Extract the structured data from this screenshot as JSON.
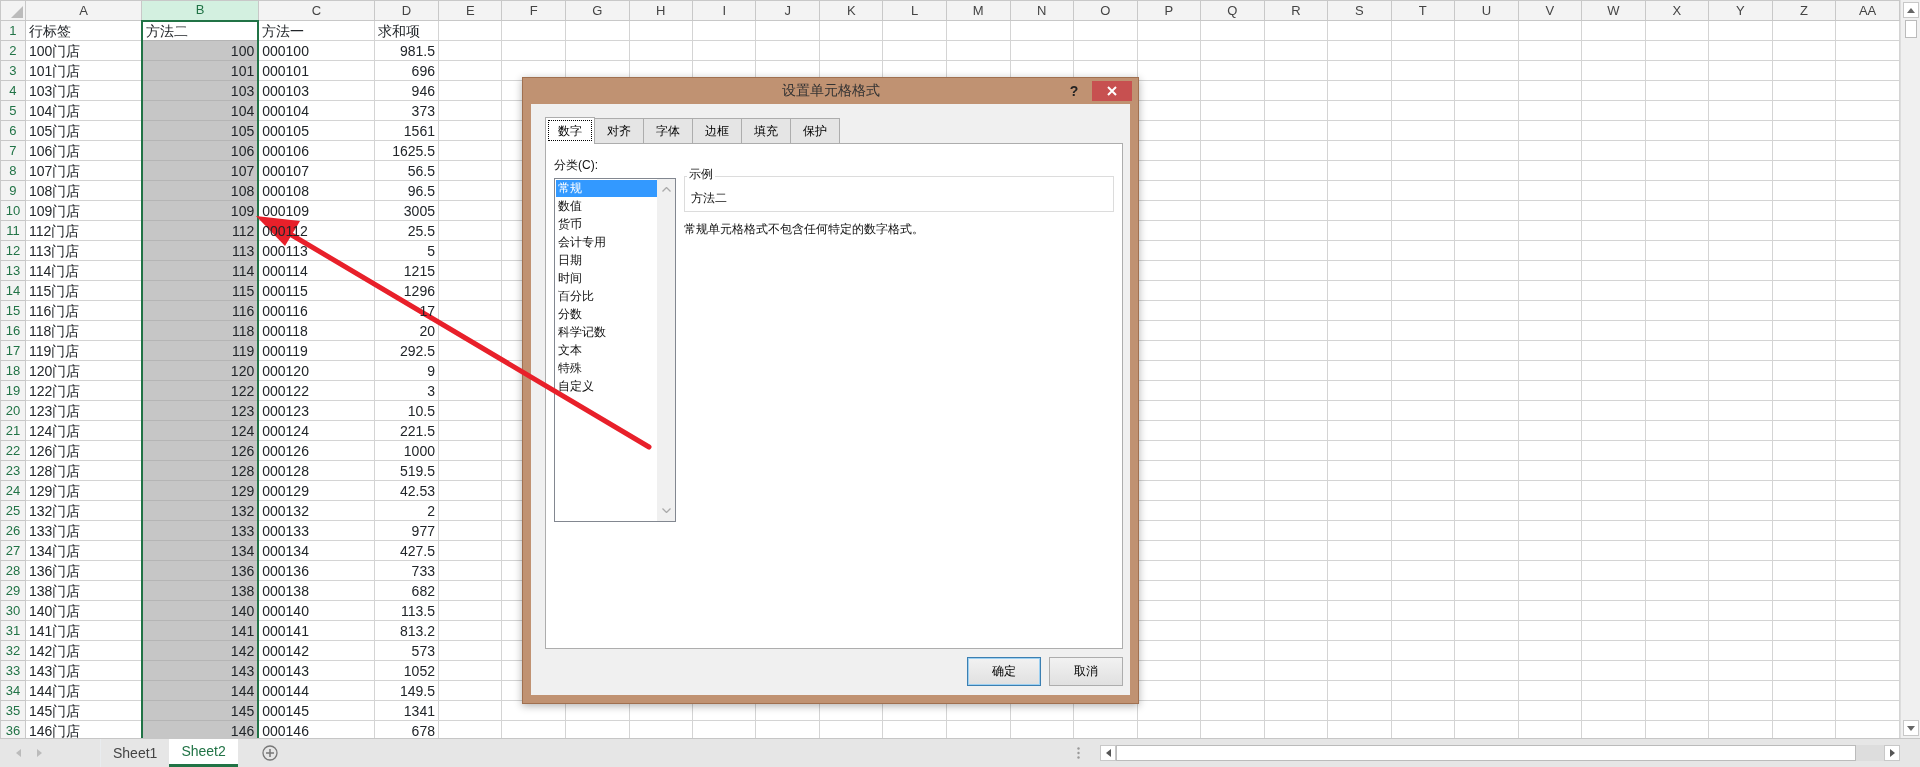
{
  "sheet": {
    "columns": [
      {
        "label": "A",
        "selected": false,
        "numeric": false
      },
      {
        "label": "B",
        "selected": true,
        "numeric": true
      },
      {
        "label": "C",
        "selected": false,
        "numeric": false
      },
      {
        "label": "D",
        "selected": false,
        "numeric": true
      },
      {
        "label": "E",
        "selected": false
      },
      {
        "label": "F",
        "selected": false
      },
      {
        "label": "G",
        "selected": false
      },
      {
        "label": "H",
        "selected": false
      },
      {
        "label": "I",
        "selected": false
      },
      {
        "label": "J",
        "selected": false
      },
      {
        "label": "K",
        "selected": false
      },
      {
        "label": "L",
        "selected": false
      },
      {
        "label": "M",
        "selected": false
      },
      {
        "label": "N",
        "selected": false
      },
      {
        "label": "O",
        "selected": false
      },
      {
        "label": "P",
        "selected": false
      },
      {
        "label": "Q",
        "selected": false
      },
      {
        "label": "R",
        "selected": false
      },
      {
        "label": "S",
        "selected": false
      },
      {
        "label": "T",
        "selected": false
      },
      {
        "label": "U",
        "selected": false
      },
      {
        "label": "V",
        "selected": false
      },
      {
        "label": "W",
        "selected": false
      },
      {
        "label": "X",
        "selected": false
      },
      {
        "label": "Y",
        "selected": false
      },
      {
        "label": "Z",
        "selected": false
      },
      {
        "label": "AA",
        "selected": false
      }
    ],
    "rows": [
      {
        "number": "1",
        "kind": "header",
        "active": true,
        "cells": [
          "行标签",
          "方法二",
          "方法一",
          "求和项"
        ]
      },
      {
        "number": "2",
        "kind": "data",
        "active": false,
        "cells": [
          "100门店",
          "100",
          "000100",
          "981.5"
        ]
      },
      {
        "number": "3",
        "kind": "data",
        "active": false,
        "cells": [
          "101门店",
          "101",
          "000101",
          "696"
        ]
      },
      {
        "number": "4",
        "kind": "data",
        "active": false,
        "cells": [
          "103门店",
          "103",
          "000103",
          "946"
        ]
      },
      {
        "number": "5",
        "kind": "data",
        "active": false,
        "cells": [
          "104门店",
          "104",
          "000104",
          "373"
        ]
      },
      {
        "number": "6",
        "kind": "data",
        "active": false,
        "cells": [
          "105门店",
          "105",
          "000105",
          "1561"
        ]
      },
      {
        "number": "7",
        "kind": "data",
        "active": false,
        "cells": [
          "106门店",
          "106",
          "000106",
          "1625.5"
        ]
      },
      {
        "number": "8",
        "kind": "data",
        "active": false,
        "cells": [
          "107门店",
          "107",
          "000107",
          "56.5"
        ]
      },
      {
        "number": "9",
        "kind": "data",
        "active": false,
        "cells": [
          "108门店",
          "108",
          "000108",
          "96.5"
        ]
      },
      {
        "number": "10",
        "kind": "data",
        "active": false,
        "cells": [
          "109门店",
          "109",
          "000109",
          "3005"
        ]
      },
      {
        "number": "11",
        "kind": "data",
        "active": false,
        "cells": [
          "112门店",
          "112",
          "000112",
          "25.5"
        ]
      },
      {
        "number": "12",
        "kind": "data",
        "active": false,
        "cells": [
          "113门店",
          "113",
          "000113",
          "5"
        ]
      },
      {
        "number": "13",
        "kind": "data",
        "active": false,
        "cells": [
          "114门店",
          "114",
          "000114",
          "1215"
        ]
      },
      {
        "number": "14",
        "kind": "data",
        "active": false,
        "cells": [
          "115门店",
          "115",
          "000115",
          "1296"
        ]
      },
      {
        "number": "15",
        "kind": "data",
        "active": false,
        "cells": [
          "116门店",
          "116",
          "000116",
          "17"
        ]
      },
      {
        "number": "16",
        "kind": "data",
        "active": false,
        "cells": [
          "118门店",
          "118",
          "000118",
          "20"
        ]
      },
      {
        "number": "17",
        "kind": "data",
        "active": false,
        "cells": [
          "119门店",
          "119",
          "000119",
          "292.5"
        ]
      },
      {
        "number": "18",
        "kind": "data",
        "active": false,
        "cells": [
          "120门店",
          "120",
          "000120",
          "9"
        ]
      },
      {
        "number": "19",
        "kind": "data",
        "active": false,
        "cells": [
          "122门店",
          "122",
          "000122",
          "3"
        ]
      },
      {
        "number": "20",
        "kind": "data",
        "active": false,
        "cells": [
          "123门店",
          "123",
          "000123",
          "10.5"
        ]
      },
      {
        "number": "21",
        "kind": "data",
        "active": false,
        "cells": [
          "124门店",
          "124",
          "000124",
          "221.5"
        ]
      },
      {
        "number": "22",
        "kind": "data",
        "active": false,
        "cells": [
          "126门店",
          "126",
          "000126",
          "1000"
        ]
      },
      {
        "number": "23",
        "kind": "data",
        "active": false,
        "cells": [
          "128门店",
          "128",
          "000128",
          "519.5"
        ]
      },
      {
        "number": "24",
        "kind": "data",
        "active": false,
        "cells": [
          "129门店",
          "129",
          "000129",
          "42.53"
        ]
      },
      {
        "number": "25",
        "kind": "data",
        "active": false,
        "cells": [
          "132门店",
          "132",
          "000132",
          "2"
        ]
      },
      {
        "number": "26",
        "kind": "data",
        "active": false,
        "cells": [
          "133门店",
          "133",
          "000133",
          "977"
        ]
      },
      {
        "number": "27",
        "kind": "data",
        "active": false,
        "cells": [
          "134门店",
          "134",
          "000134",
          "427.5"
        ]
      },
      {
        "number": "28",
        "kind": "data",
        "active": false,
        "cells": [
          "136门店",
          "136",
          "000136",
          "733"
        ]
      },
      {
        "number": "29",
        "kind": "data",
        "active": false,
        "cells": [
          "138门店",
          "138",
          "000138",
          "682"
        ]
      },
      {
        "number": "30",
        "kind": "data",
        "active": false,
        "cells": [
          "140门店",
          "140",
          "000140",
          "113.5"
        ]
      },
      {
        "number": "31",
        "kind": "data",
        "active": false,
        "cells": [
          "141门店",
          "141",
          "000141",
          "813.2"
        ]
      },
      {
        "number": "32",
        "kind": "data",
        "active": false,
        "cells": [
          "142门店",
          "142",
          "000142",
          "573"
        ]
      },
      {
        "number": "33",
        "kind": "data",
        "active": false,
        "cells": [
          "143门店",
          "143",
          "000143",
          "1052"
        ]
      },
      {
        "number": "34",
        "kind": "data",
        "active": false,
        "cells": [
          "144门店",
          "144",
          "000144",
          "149.5"
        ]
      },
      {
        "number": "35",
        "kind": "data",
        "active": false,
        "cells": [
          "145门店",
          "145",
          "000145",
          "1341"
        ]
      },
      {
        "number": "36",
        "kind": "data",
        "active": false,
        "cells": [
          "146门店",
          "146",
          "000146",
          "678"
        ]
      }
    ]
  },
  "sheet_tabs": [
    {
      "label": "Sheet1",
      "selected": false
    },
    {
      "label": "Sheet2",
      "selected": true
    }
  ],
  "dialog": {
    "title": "设置单元格格式",
    "help": "?",
    "tabs": [
      {
        "label": "数字",
        "selected": true
      },
      {
        "label": "对齐",
        "selected": false
      },
      {
        "label": "字体",
        "selected": false
      },
      {
        "label": "边框",
        "selected": false
      },
      {
        "label": "填充",
        "selected": false
      },
      {
        "label": "保护",
        "selected": false
      }
    ],
    "category_label": "分类(C):",
    "categories": [
      {
        "label": "常规",
        "selected": true
      },
      {
        "label": "数值",
        "selected": false
      },
      {
        "label": "货币",
        "selected": false
      },
      {
        "label": "会计专用",
        "selected": false
      },
      {
        "label": "日期",
        "selected": false
      },
      {
        "label": "时间",
        "selected": false
      },
      {
        "label": "百分比",
        "selected": false
      },
      {
        "label": "分数",
        "selected": false
      },
      {
        "label": "科学记数",
        "selected": false
      },
      {
        "label": "文本",
        "selected": false
      },
      {
        "label": "特殊",
        "selected": false
      },
      {
        "label": "自定义",
        "selected": false
      }
    ],
    "sample_label": "示例",
    "sample_value": "方法二",
    "description": "常规单元格格式不包含任何特定的数字格式。",
    "buttons": [
      {
        "label": "确定",
        "default": true
      },
      {
        "label": "取消",
        "default": false
      }
    ]
  }
}
